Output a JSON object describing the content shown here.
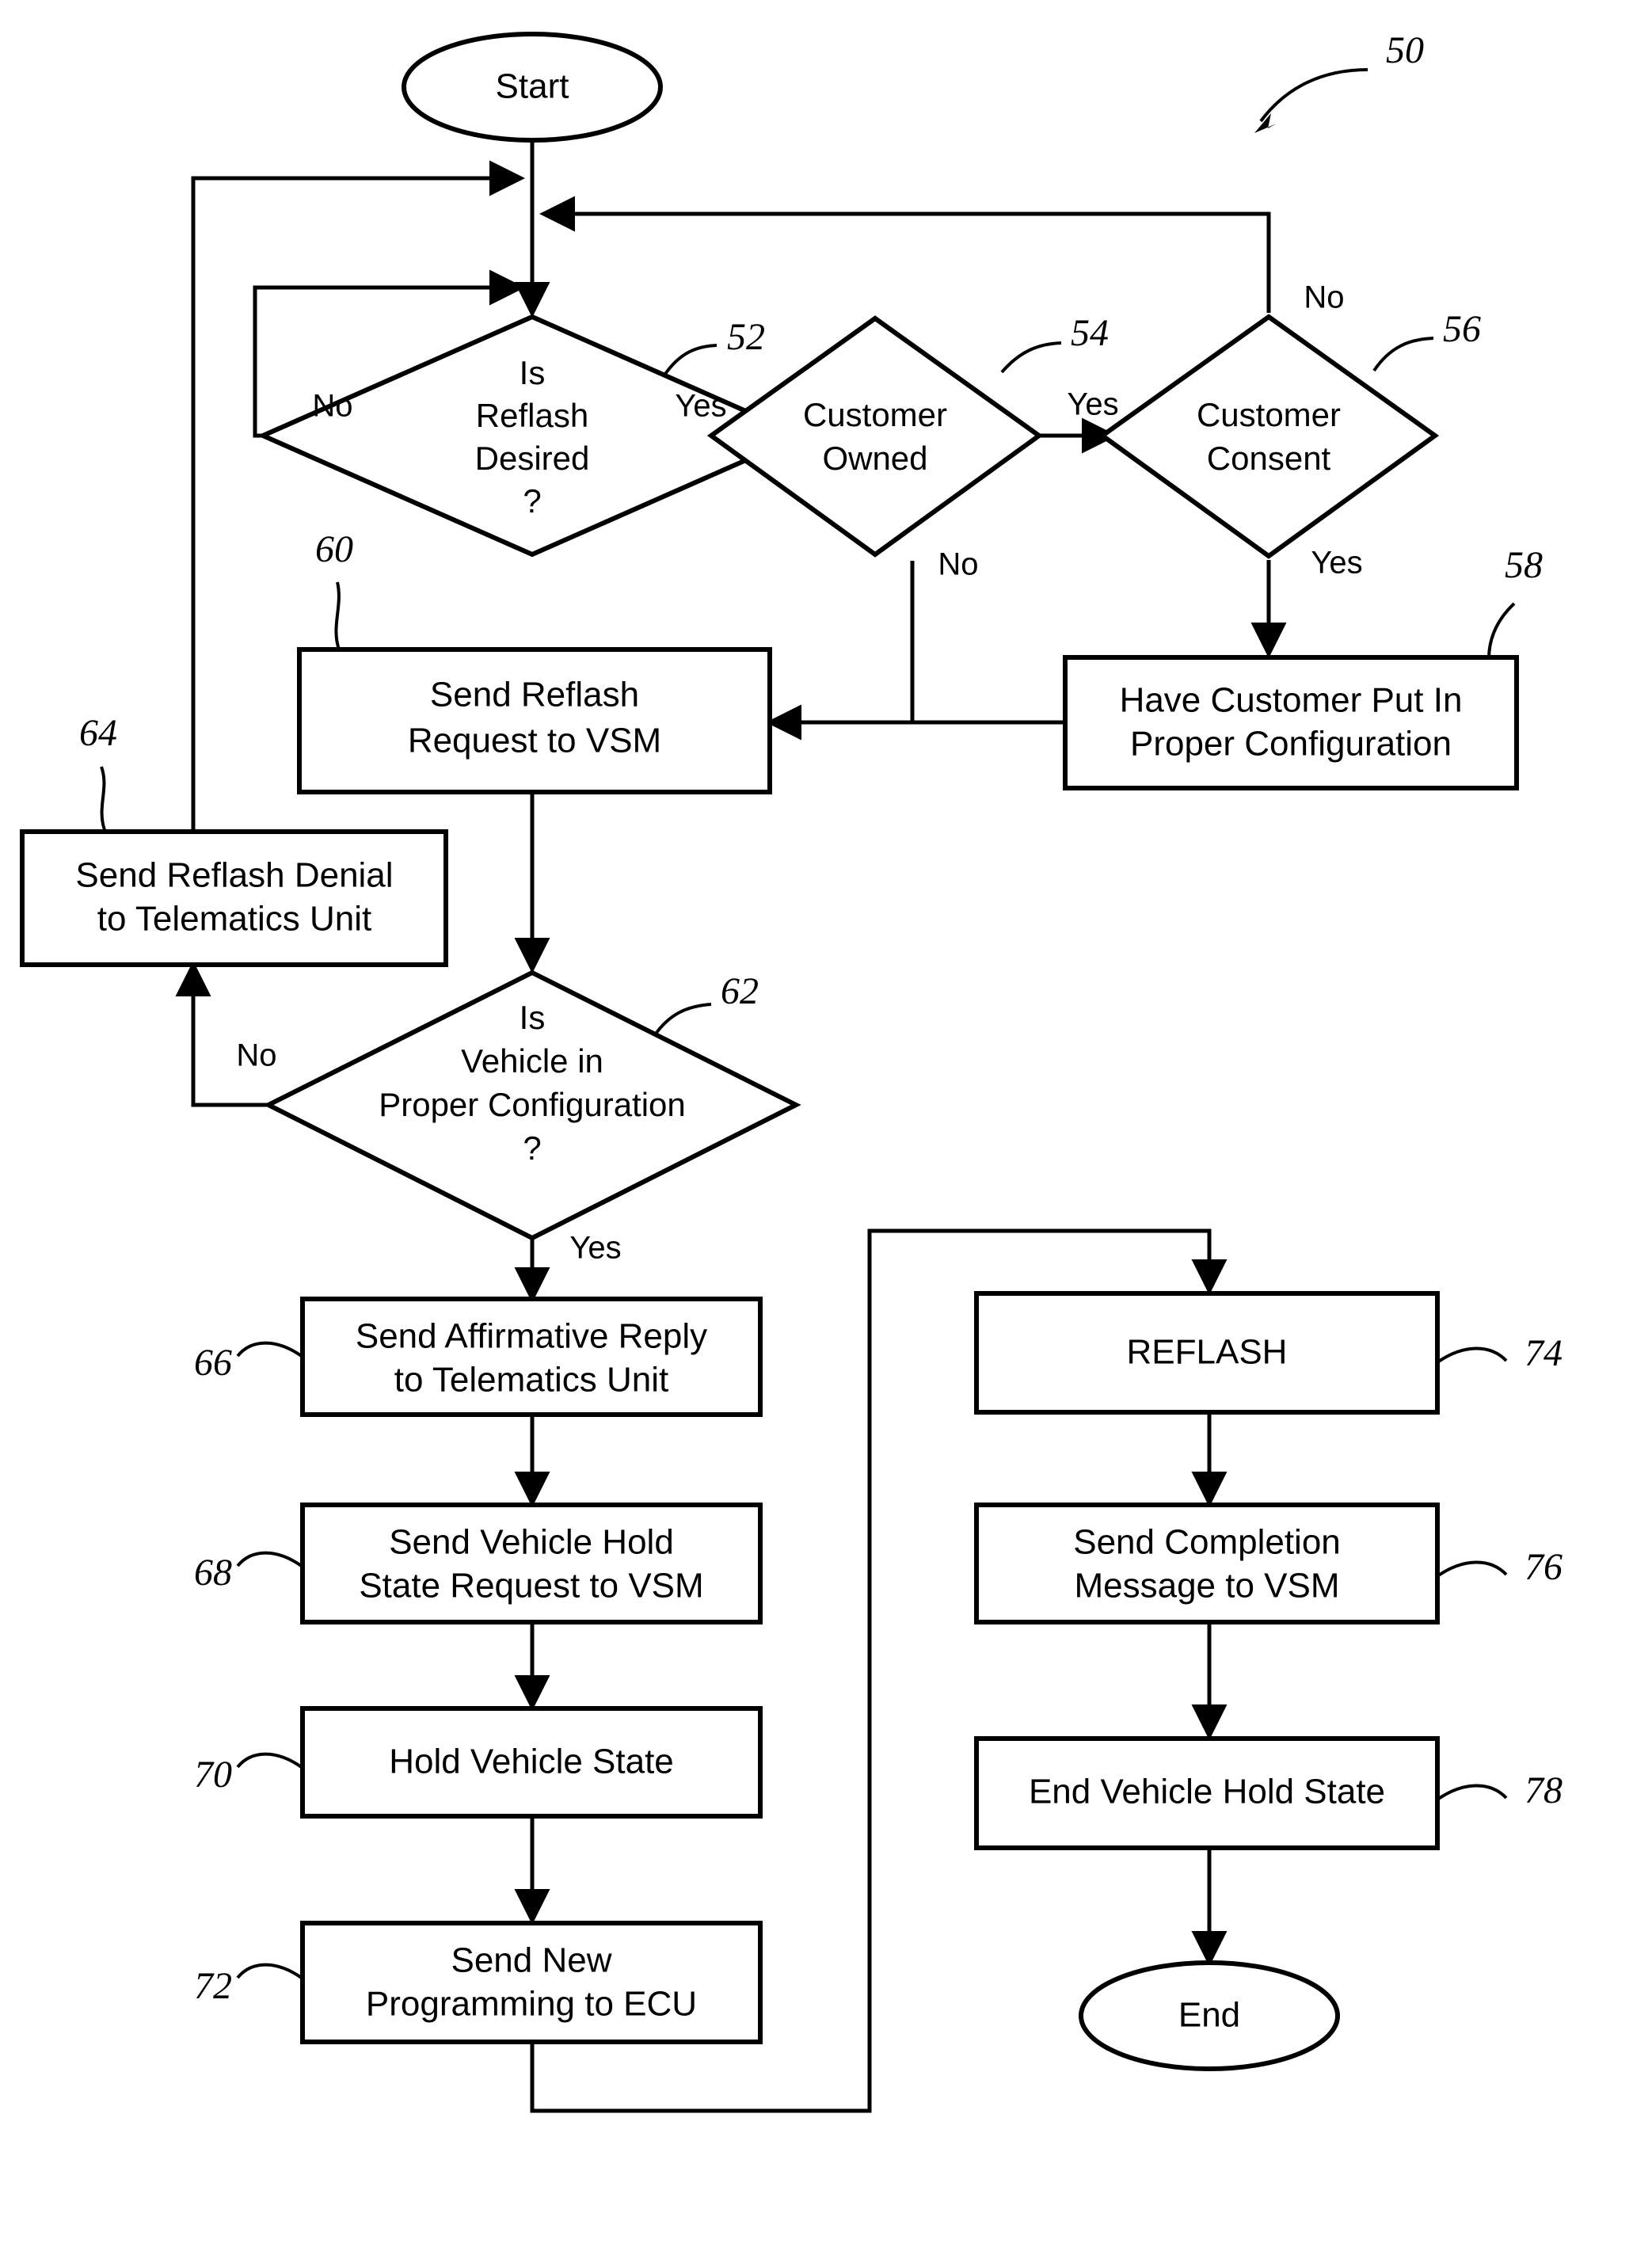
{
  "figure": {
    "reference_numeral": "50",
    "terminators": {
      "start": "Start",
      "end": "End"
    },
    "nodes": [
      {
        "id": "start",
        "ref": "",
        "type": "terminator",
        "text": "Start"
      },
      {
        "id": "n52",
        "ref": "52",
        "type": "decision",
        "text": "Is Reflash Desired ?",
        "lines": [
          "Is",
          "Reflash",
          "Desired",
          "?"
        ]
      },
      {
        "id": "n54",
        "ref": "54",
        "type": "decision",
        "text": "Customer Owned",
        "lines": [
          "Customer",
          "Owned"
        ]
      },
      {
        "id": "n56",
        "ref": "56",
        "type": "decision",
        "text": "Customer Consent",
        "lines": [
          "Customer",
          "Consent"
        ]
      },
      {
        "id": "n58",
        "ref": "58",
        "type": "process",
        "text": "Have Customer Put In Proper Configuration",
        "lines": [
          "Have Customer Put In",
          "Proper Configuration"
        ]
      },
      {
        "id": "n60",
        "ref": "60",
        "type": "process",
        "text": "Send Reflash Request to VSM",
        "lines": [
          "Send Reflash",
          "Request to VSM"
        ]
      },
      {
        "id": "n62",
        "ref": "62",
        "type": "decision",
        "text": "Is Vehicle in Proper Configuration ?",
        "lines": [
          "Is",
          "Vehicle in",
          "Proper Configuration",
          "?"
        ]
      },
      {
        "id": "n64",
        "ref": "64",
        "type": "process",
        "text": "Send Reflash Denial to Telematics Unit",
        "lines": [
          "Send Reflash Denial",
          "to Telematics Unit"
        ]
      },
      {
        "id": "n66",
        "ref": "66",
        "type": "process",
        "text": "Send Affirmative Reply to Telematics Unit",
        "lines": [
          "Send Affirmative Reply",
          "to Telematics Unit"
        ]
      },
      {
        "id": "n68",
        "ref": "68",
        "type": "process",
        "text": "Send Vehicle Hold State Request to VSM",
        "lines": [
          "Send Vehicle Hold",
          "State Request to VSM"
        ]
      },
      {
        "id": "n70",
        "ref": "70",
        "type": "process",
        "text": "Hold Vehicle State",
        "lines": [
          "Hold Vehicle State"
        ]
      },
      {
        "id": "n72",
        "ref": "72",
        "type": "process",
        "text": "Send New Programming to ECU",
        "lines": [
          "Send New",
          "Programming to ECU"
        ]
      },
      {
        "id": "n74",
        "ref": "74",
        "type": "process",
        "text": "REFLASH",
        "lines": [
          "REFLASH"
        ]
      },
      {
        "id": "n76",
        "ref": "76",
        "type": "process",
        "text": "Send Completion Message to VSM",
        "lines": [
          "Send Completion",
          "Message to VSM"
        ]
      },
      {
        "id": "n78",
        "ref": "78",
        "type": "process",
        "text": "End Vehicle Hold State",
        "lines": [
          "End Vehicle Hold State"
        ]
      },
      {
        "id": "end",
        "ref": "",
        "type": "terminator",
        "text": "End"
      }
    ],
    "edge_labels": {
      "n52_no": "No",
      "n52_yes": "Yes",
      "n54_yes": "Yes",
      "n54_no": "No",
      "n56_no": "No",
      "n56_yes": "Yes",
      "n62_no": "No",
      "n62_yes": "Yes"
    },
    "text": {
      "start": "Start",
      "end": "End",
      "n52_l1": "Is",
      "n52_l2": "Reflash",
      "n52_l3": "Desired",
      "n52_l4": "?",
      "n54_l1": "Customer",
      "n54_l2": "Owned",
      "n56_l1": "Customer",
      "n56_l2": "Consent",
      "n58_l1": "Have Customer Put In",
      "n58_l2": "Proper Configuration",
      "n60_l1": "Send Reflash",
      "n60_l2": "Request to VSM",
      "n62_l1": "Is",
      "n62_l2": "Vehicle in",
      "n62_l3": "Proper Configuration",
      "n62_l4": "?",
      "n64_l1": "Send Reflash Denial",
      "n64_l2": "to Telematics Unit",
      "n66_l1": "Send Affirmative Reply",
      "n66_l2": "to Telematics Unit",
      "n68_l1": "Send Vehicle Hold",
      "n68_l2": "State Request to VSM",
      "n70_l1": "Hold Vehicle State",
      "n72_l1": "Send New",
      "n72_l2": "Programming to ECU",
      "n74_l1": "REFLASH",
      "n76_l1": "Send Completion",
      "n76_l2": "Message to VSM",
      "n78_l1": "End Vehicle Hold State"
    },
    "refs": {
      "r50": "50",
      "r52": "52",
      "r54": "54",
      "r56": "56",
      "r58": "58",
      "r60": "60",
      "r62": "62",
      "r64": "64",
      "r66": "66",
      "r68": "68",
      "r70": "70",
      "r72": "72",
      "r74": "74",
      "r76": "76",
      "r78": "78"
    },
    "colors": {
      "ink": "#000000",
      "background": "#ffffff"
    }
  }
}
